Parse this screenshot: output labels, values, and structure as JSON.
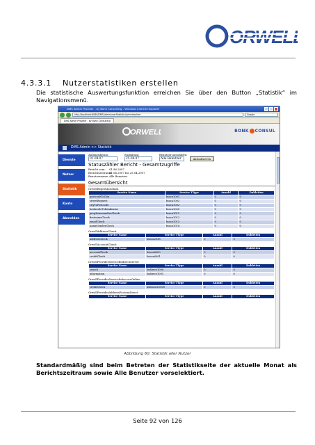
{
  "header": {
    "logo_text": "ORWELL"
  },
  "section": {
    "number": "4.3.3.1",
    "title": "Nutzerstatistiken erstellen",
    "paragraph": "Die statistische Auswertungsfunktion erreichen Sie über den Button „Statistik“ im Navigationsmenü."
  },
  "screenshot": {
    "window_title": "DMS Admin Provider - by Bonk Consulting - Windows Internet Explorer",
    "url": "http://localhost:8080/DMSAdmin/userStatistic/overview.htm",
    "search_placeholder": "Google",
    "tab_label": "DMS Admin Provider - by Bonk Consulting",
    "banner": {
      "logo_text": "ORWELL",
      "partner_pre": "BONK",
      "partner_post": "CONSUL"
    },
    "breadcrumb": "DMS Admin >> Statistik",
    "sidebar": [
      {
        "label": "Dienste",
        "active": false
      },
      {
        "label": "Nutzer",
        "active": false
      },
      {
        "label": "Statistik",
        "active": true
      },
      {
        "label": "Konto",
        "active": false
      },
      {
        "label": "Abmelden",
        "active": false
      }
    ],
    "filters": {
      "start_label": "Anfangsdatum:",
      "start_value": "01.04.07",
      "end_label": "Enddatum:",
      "end_value": "25.04.07",
      "user_label": "Benutzer auswählen:",
      "user_value": "Alle Benutzer",
      "button": "Aktualisieren"
    },
    "report_title": "Statuszähler Bericht - Gesamtzugriffe",
    "info": [
      {
        "k": "Bericht vom:",
        "v": "01.96.2007"
      },
      {
        "k": "Berichtszeitraum:",
        "v": "01.04.2007 bis 25.04.2007"
      },
      {
        "k": "Benutzername:",
        "v": "Alle Benutzer"
      }
    ],
    "overview_title": "Gesamtübersicht",
    "columns": [
      "Service Name",
      "Service TType",
      "Anzahl",
      "Dubletten"
    ],
    "groups": [
      {
        "name": "OrwellExpertAssistant",
        "rows": [
          [
            "postcodeToCity",
            "bsoca1001",
            "0",
            "0"
          ],
          [
            "streetRequest",
            "bsoca1003",
            "0",
            "0"
          ],
          [
            "cityToPostcode",
            "bsoca1002",
            "0",
            "0"
          ],
          [
            "bankcodeToBankname",
            "bsoca1020",
            "0",
            "0"
          ],
          [
            "prephonenumberCheck",
            "bsoca1011",
            "0",
            "0"
          ],
          [
            "firstnameCheck",
            "bsoca1012",
            "0",
            "0"
          ],
          [
            "emailCheck",
            "bsoca1013",
            "0",
            "0"
          ],
          [
            "nameGenderCheck",
            "bsoca1014",
            "0",
            "0"
          ]
        ]
      },
      {
        "name": "OrwellAddressCheck",
        "rows": [
          [
            "addressCheck",
            "bsoca2038",
            "0",
            "0"
          ]
        ]
      },
      {
        "name": "OrwellAccountCheck",
        "rows": [
          [
            "accountCheck",
            "bsoca6000",
            "0",
            "0"
          ],
          [
            "creditCheck",
            "bsoca6001",
            "0",
            "0"
          ]
        ]
      },
      {
        "name": "OrwellProviderServiceBedirectServer",
        "rows": [
          [
            "search",
            "bsdirect1000",
            "0",
            "0"
          ],
          [
            "information",
            "bsdirect1001",
            "0",
            "0"
          ]
        ]
      },
      {
        "name": "OrwellProviderServiceInfoscoreOnline",
        "rows": [
          [
            "creditCheck",
            "infoscore1000",
            "0",
            "0"
          ]
        ]
      },
      {
        "name": "OrwellProviderAddressFactoryDirect",
        "rows": []
      }
    ]
  },
  "caption": "Abbildung 60: Statistik aller Nutzer",
  "bold_paragraph": "Standardmäßig sind beim Betreten der Statistikseite der aktuelle Monat als Berichtszeitraum sowie Alle Benutzer vorselektiert.",
  "footer": {
    "page": "Seite 92 von 126"
  },
  "colors": {
    "brand_blue": "#2c4f9e",
    "nav_blue": "#1e4bb8",
    "active_orange": "#e2581b",
    "header_dark": "#0b2c84"
  }
}
